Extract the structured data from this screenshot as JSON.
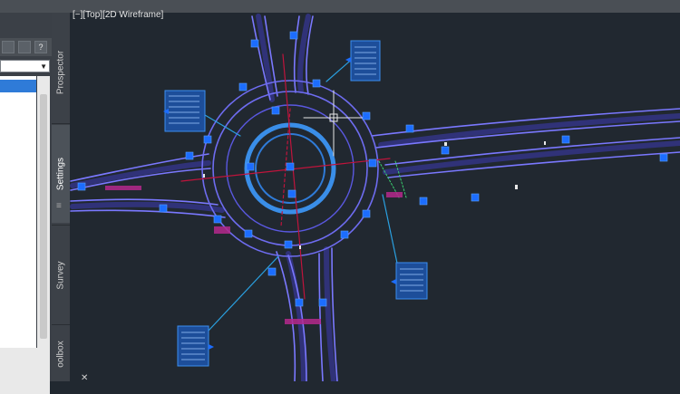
{
  "viewport": {
    "label": "[−][Top][2D Wireframe]"
  },
  "toolbar": {
    "help_label": "?"
  },
  "palette": {
    "tabs": [
      "Prospector",
      "Settings",
      "Survey",
      "oolbox"
    ],
    "active_tab": "Settings"
  },
  "colors": {
    "background": "#212830",
    "road": "#6e6cf0",
    "grip": "#1c6dff",
    "axis_red": "#c0143c",
    "label_magenta": "#b4288c",
    "leader": "#2aa0e0"
  }
}
